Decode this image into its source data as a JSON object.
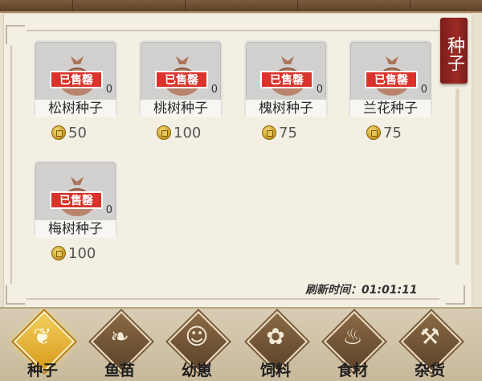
{
  "shop": {
    "category_tag": "种子",
    "sold_label": "已售罄",
    "refresh_label": "刷新时间：",
    "refresh_time": "01:01:11",
    "items": [
      {
        "name": "松树种子",
        "count": "0",
        "price": "50"
      },
      {
        "name": "桃树种子",
        "count": "0",
        "price": "100"
      },
      {
        "name": "槐树种子",
        "count": "0",
        "price": "75"
      },
      {
        "name": "兰花种子",
        "count": "0",
        "price": "75"
      },
      {
        "name": "梅树种子",
        "count": "0",
        "price": "100"
      }
    ]
  },
  "tabs": [
    {
      "label": "种子",
      "icon": "seed-icon",
      "active": true
    },
    {
      "label": "鱼苗",
      "icon": "fish-icon",
      "active": false
    },
    {
      "label": "幼崽",
      "icon": "pig-icon",
      "active": false
    },
    {
      "label": "饲料",
      "icon": "feed-icon",
      "active": false
    },
    {
      "label": "食材",
      "icon": "teapot-icon",
      "active": false
    },
    {
      "label": "杂货",
      "icon": "axe-icon",
      "active": false
    }
  ],
  "colors": {
    "sold_banner": "#d9332b",
    "side_tag": "#9c2a24",
    "active_tab": "#f3cf5d"
  }
}
